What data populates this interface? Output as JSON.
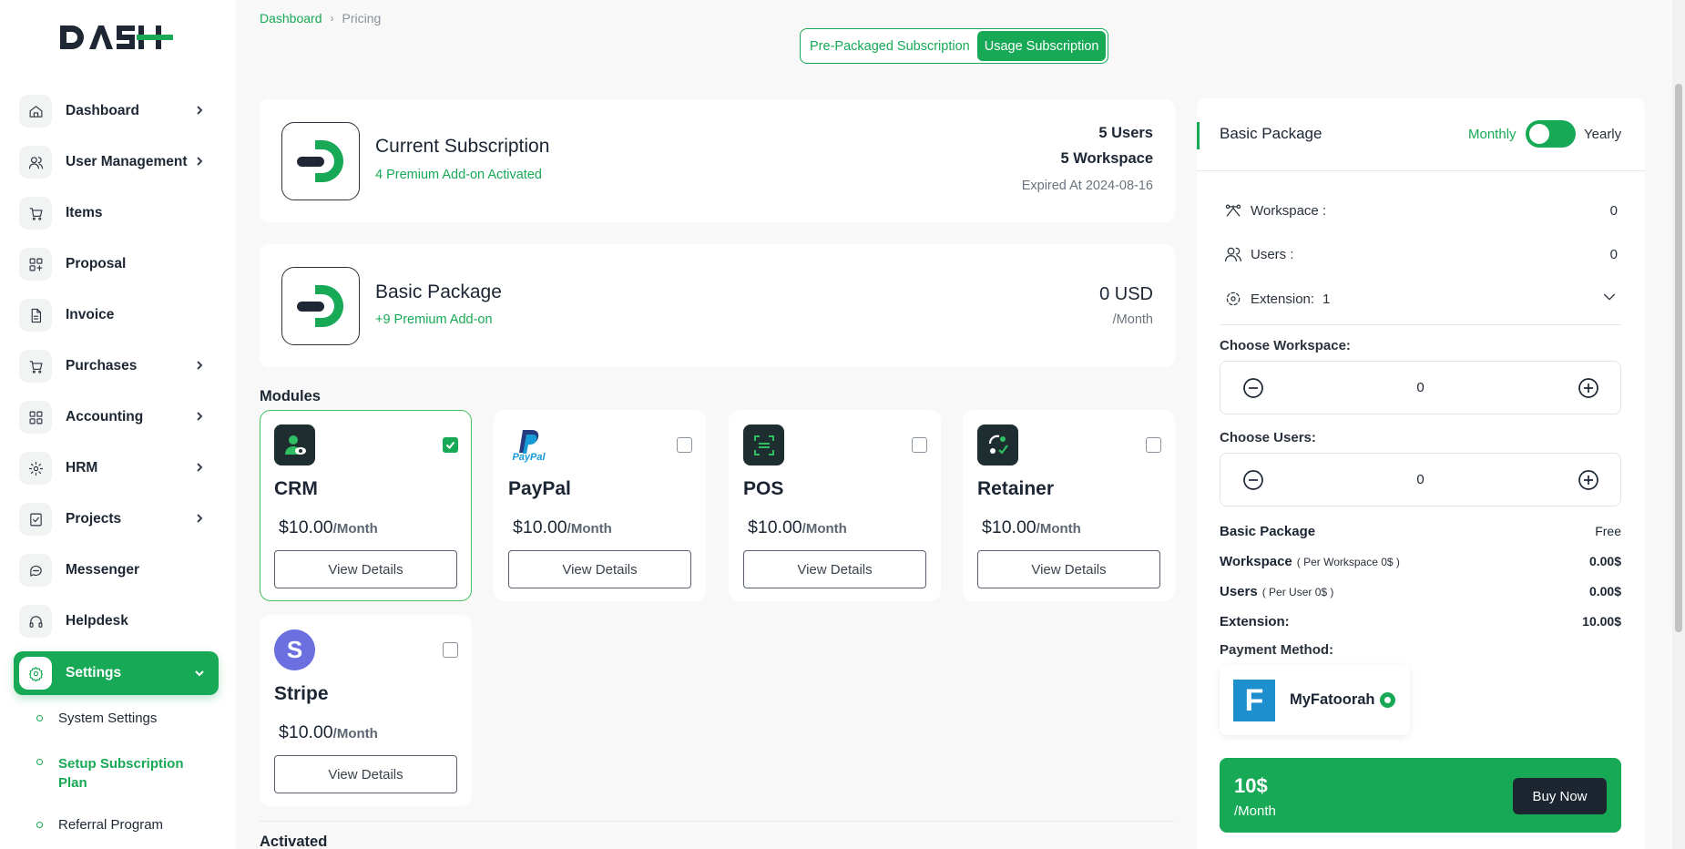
{
  "app": {
    "logo_text": "DASH"
  },
  "sidebar": {
    "items": [
      {
        "label": "Dashboard",
        "icon": "home-icon",
        "has_children": true
      },
      {
        "label": "User Management",
        "icon": "users-icon",
        "has_children": true
      },
      {
        "label": "Items",
        "icon": "cart-icon",
        "has_children": false
      },
      {
        "label": "Proposal",
        "icon": "proposal-icon",
        "has_children": false
      },
      {
        "label": "Invoice",
        "icon": "invoice-icon",
        "has_children": false
      },
      {
        "label": "Purchases",
        "icon": "cart-icon",
        "has_children": true
      },
      {
        "label": "Accounting",
        "icon": "accounting-icon",
        "has_children": true
      },
      {
        "label": "HRM",
        "icon": "hrm-icon",
        "has_children": true
      },
      {
        "label": "Projects",
        "icon": "projects-icon",
        "has_children": true
      },
      {
        "label": "Messenger",
        "icon": "chat-icon",
        "has_children": false
      },
      {
        "label": "Helpdesk",
        "icon": "headset-icon",
        "has_children": false
      },
      {
        "label": "Settings",
        "icon": "gear-icon",
        "has_children": true,
        "active": true
      }
    ],
    "sub_items": [
      {
        "label": "System Settings"
      },
      {
        "label": "Setup Subscription Plan",
        "active": true
      },
      {
        "label": "Referral Program"
      }
    ]
  },
  "breadcrumb": {
    "home": "Dashboard",
    "separator": "›",
    "current": "Pricing"
  },
  "tabs": {
    "prepackaged": "Pre-Packaged Subscription",
    "usage": "Usage Subscription",
    "active": "usage"
  },
  "current_subscription": {
    "title": "Current Subscription",
    "subtitle": "4 Premium Add-on Activated",
    "users": "5 Users",
    "workspace": "5 Workspace",
    "expires": "Expired At 2024-08-16"
  },
  "basic_package_card": {
    "title": "Basic Package",
    "subtitle": "+9 Premium Add-on",
    "price": "0 USD",
    "period": "/Month"
  },
  "modules": {
    "heading": "Modules",
    "button_label": "View Details",
    "items": [
      {
        "name": "CRM",
        "price": "$10.00",
        "period": "/Month",
        "checked": true,
        "icon": "crm-icon"
      },
      {
        "name": "PayPal",
        "price": "$10.00",
        "period": "/Month",
        "checked": false,
        "icon": "paypal-icon",
        "logo_text": "PayPal"
      },
      {
        "name": "POS",
        "price": "$10.00",
        "period": "/Month",
        "checked": false,
        "icon": "pos-icon"
      },
      {
        "name": "Retainer",
        "price": "$10.00",
        "period": "/Month",
        "checked": false,
        "icon": "retainer-icon"
      },
      {
        "name": "Stripe",
        "price": "$10.00",
        "period": "/Month",
        "checked": false,
        "icon": "stripe-icon",
        "logo_text": "S"
      }
    ]
  },
  "activated_heading": "Activated",
  "panel": {
    "title": "Basic Package",
    "toggle": {
      "left": "Monthly",
      "right": "Yearly",
      "state": "monthly"
    },
    "rows": [
      {
        "label": "Workspace :",
        "value": "0",
        "icon": "workspace-icon"
      },
      {
        "label": "Users :",
        "value": "0",
        "icon": "users-icon"
      },
      {
        "label": "Extension:",
        "value": "1",
        "icon": "extension-icon"
      }
    ],
    "choose_workspace": {
      "label": "Choose Workspace:",
      "value": "0"
    },
    "choose_users": {
      "label": "Choose Users:",
      "value": "0"
    },
    "summary": [
      {
        "label": "Basic Package",
        "note": "",
        "value": "Free"
      },
      {
        "label": "Workspace",
        "note": "( Per Workspace 0$ )",
        "value": "0.00$"
      },
      {
        "label": "Users",
        "note": "( Per User 0$ )",
        "value": "0.00$"
      },
      {
        "label": "Extension:",
        "note": "",
        "value": "10.00$"
      }
    ],
    "payment_method_label": "Payment Method:",
    "payment": {
      "name": "MyFatoorah",
      "logo_text": "F",
      "selected": true
    },
    "total": {
      "amount": "10$",
      "period": "/Month",
      "button": "Buy Now"
    }
  },
  "colors": {
    "accent": "#17a956",
    "dark": "#1c2530",
    "text": "#1b2533",
    "muted": "#8a929b"
  }
}
